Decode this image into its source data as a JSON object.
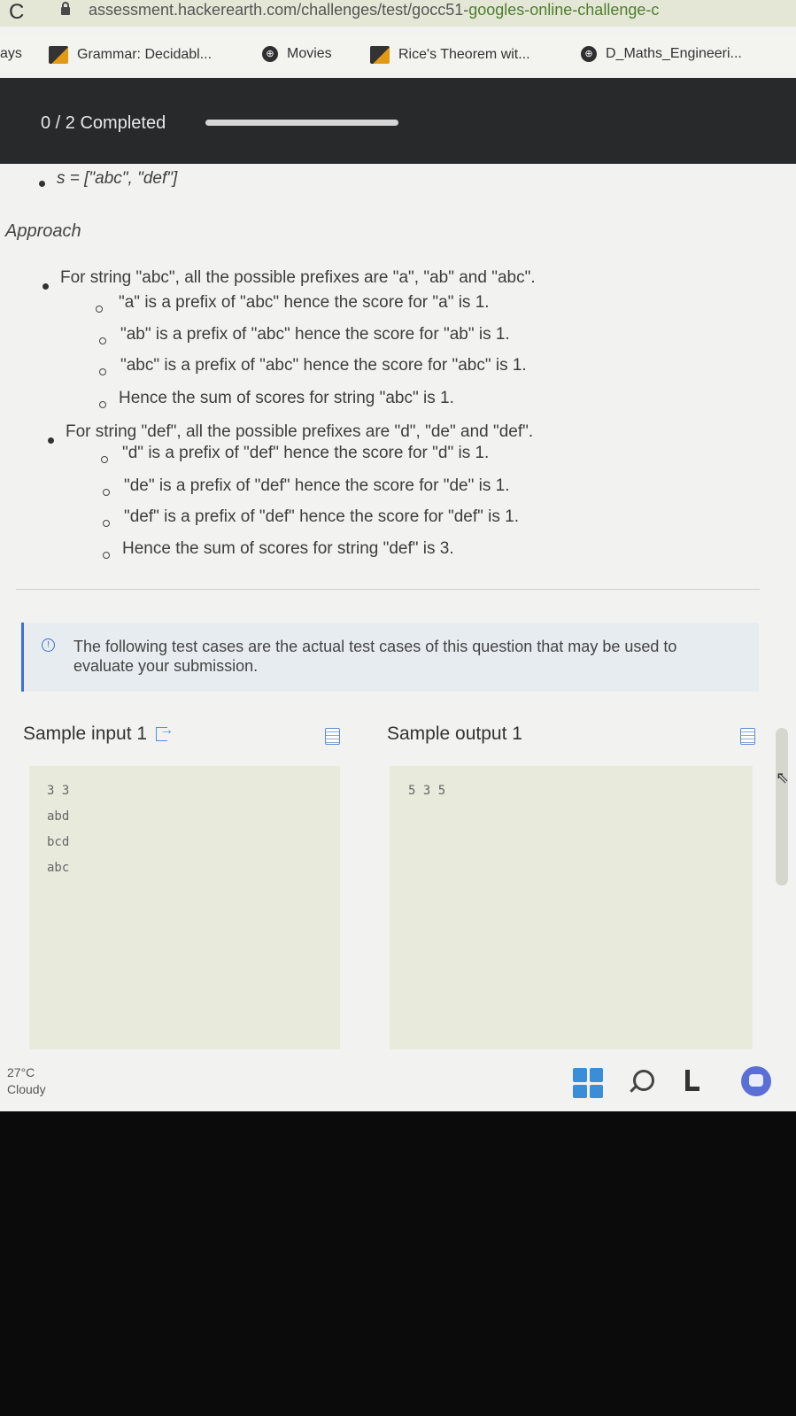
{
  "browser": {
    "url_prefix": "assessment.hackerearth.com/challenges/test/gocc51-",
    "url_highlight": "googles-online-challenge-c",
    "bookmarks": [
      {
        "label": "ays",
        "icon": "none"
      },
      {
        "label": "Grammar: Decidabl...",
        "icon": "bookmark-favicon"
      },
      {
        "label": "Movies",
        "icon": "globe-icon"
      },
      {
        "label": "Rice's Theorem wit...",
        "icon": "bookmark-favicon"
      },
      {
        "label": "D_Maths_Engineeri...",
        "icon": "globe-icon"
      }
    ]
  },
  "progress": {
    "label": "0 / 2 Completed",
    "value": 0.0,
    "accent": "#4a90e2"
  },
  "content": {
    "s_line": "s = [\"abc\", \"def\"]",
    "approach_heading": "Approach",
    "bullets": [
      {
        "text": "For string \"abc\", all the possible prefixes are \"a\", \"ab\" and \"abc\".",
        "sub": [
          "\"a\" is a prefix of \"abc\" hence the score for \"a\" is 1.",
          "\"ab\" is a prefix of \"abc\" hence the score for \"ab\" is 1.",
          "\"abc\" is a prefix of \"abc\" hence the score for \"abc\" is 1.",
          "Hence the sum of scores for string \"abc\" is 1."
        ]
      },
      {
        "text": "For string \"def\", all the possible prefixes are \"d\", \"de\" and \"def\".",
        "sub": [
          "\"d\" is a prefix of \"def\" hence the score for \"d\" is 1.",
          "\"de\" is a prefix of \"def\" hence the score for \"de\" is 1.",
          "\"def\" is a prefix of \"def\" hence the score for \"def\" is 1.",
          "Hence the sum of scores for string \"def\" is 3."
        ]
      }
    ],
    "note": "The following test cases are the actual test cases of this question that may be used to evaluate your submission."
  },
  "samples": {
    "input_label": "Sample input 1",
    "output_label": "Sample output 1",
    "input_lines": [
      "3 3",
      "abd",
      "bcd",
      "abc"
    ],
    "output_lines": [
      "5 3 5"
    ]
  },
  "taskbar": {
    "temperature": "27°C",
    "condition": "Cloudy"
  }
}
